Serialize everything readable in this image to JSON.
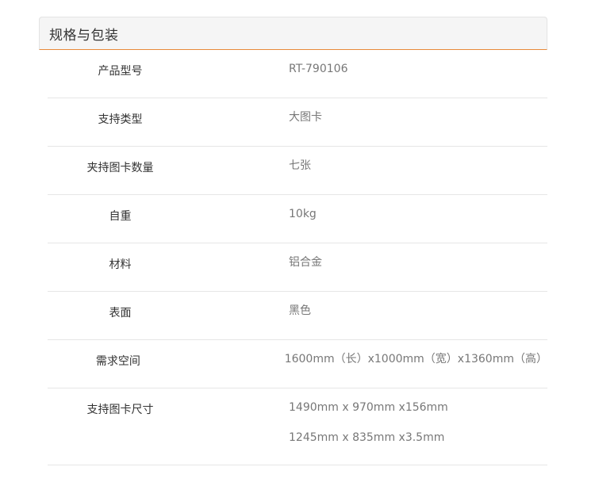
{
  "panel": {
    "title": "规格与包装"
  },
  "specs": [
    {
      "label": "产品型号",
      "values": [
        "RT-790106"
      ]
    },
    {
      "label": "支持类型",
      "values": [
        "大图卡"
      ]
    },
    {
      "label": "夹持图卡数量",
      "values": [
        "七张"
      ]
    },
    {
      "label": "自重",
      "values": [
        "10kg"
      ]
    },
    {
      "label": "材料",
      "values": [
        "铝合金"
      ]
    },
    {
      "label": "表面",
      "values": [
        "黑色"
      ]
    },
    {
      "label": "需求空间",
      "values": [
        "1600mm（长）x1000mm（宽）x1360mm（高）"
      ]
    },
    {
      "label": "支持图卡尺寸",
      "values": [
        "1490mm x 970mm x156mm",
        "1245mm x 835mm x3.5mm"
      ]
    }
  ],
  "colors": {
    "accent_underline": "#e8893a",
    "header_bg": "#f5f5f5",
    "label_text": "#333333",
    "value_text": "#777777",
    "row_divider": "#e6e6e6"
  }
}
